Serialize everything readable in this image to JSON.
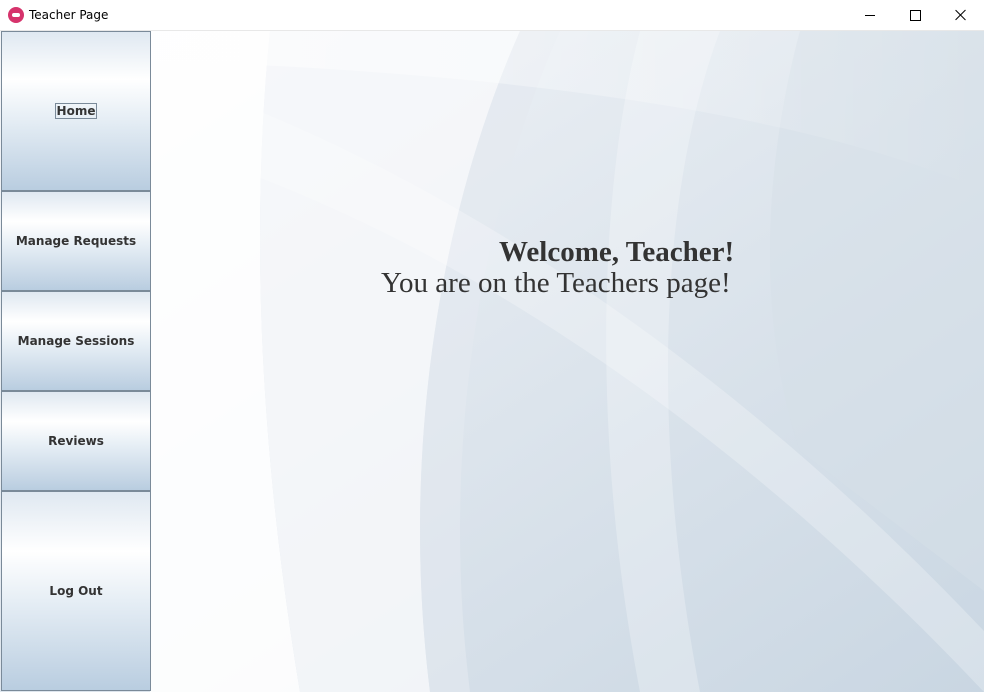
{
  "window": {
    "title": "Teacher Page",
    "icon": "app-logo-icon",
    "controls": [
      "minimize-icon",
      "maximize-icon",
      "close-icon"
    ]
  },
  "sidebar": {
    "items": [
      {
        "label": "Home",
        "focused": true
      },
      {
        "label": "Manage Requests"
      },
      {
        "label": "Manage Sessions"
      },
      {
        "label": "Reviews"
      },
      {
        "label": "Log Out"
      }
    ]
  },
  "main": {
    "welcome": "Welcome, Teacher!",
    "subtitle": "You are on the Teachers page!"
  },
  "colors": {
    "text": "#333333",
    "button_border": "#7a8a99",
    "button_gradient_bottom": "#b9cde0",
    "background": "#eef2f6"
  }
}
